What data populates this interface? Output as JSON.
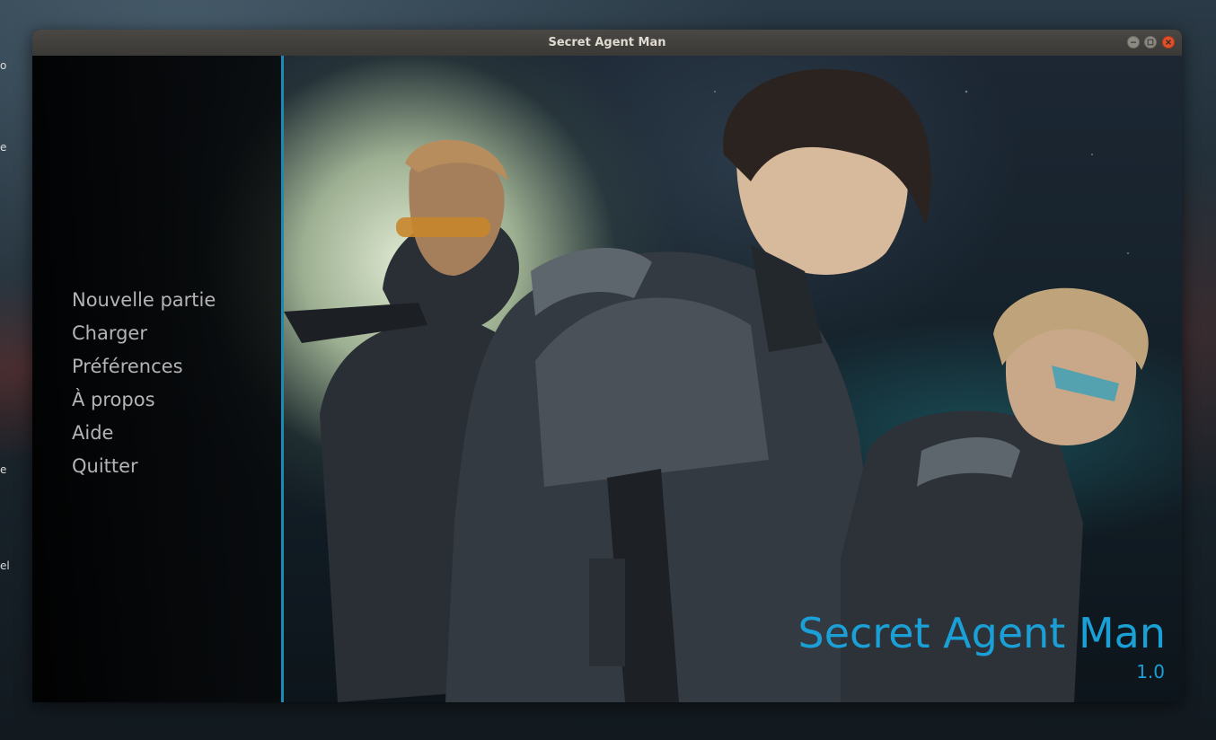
{
  "window": {
    "title": "Secret Agent Man"
  },
  "desktop": {
    "edge_labels": [
      "o",
      "e",
      "e",
      "el"
    ]
  },
  "menu": {
    "items": [
      {
        "label": "Nouvelle partie"
      },
      {
        "label": "Charger"
      },
      {
        "label": "Préférences"
      },
      {
        "label": "À propos"
      },
      {
        "label": "Aide"
      },
      {
        "label": "Quitter"
      }
    ]
  },
  "game": {
    "title": "Secret Agent Man",
    "version": "1.0"
  },
  "colors": {
    "accent": "#1aa0d6",
    "menu_text": "#b4b4b4",
    "close_button": "#e0502a",
    "titlebar": "#3f3e3a"
  },
  "icons": {
    "minimize": "minimize-icon",
    "maximize": "maximize-icon",
    "close": "close-icon"
  }
}
